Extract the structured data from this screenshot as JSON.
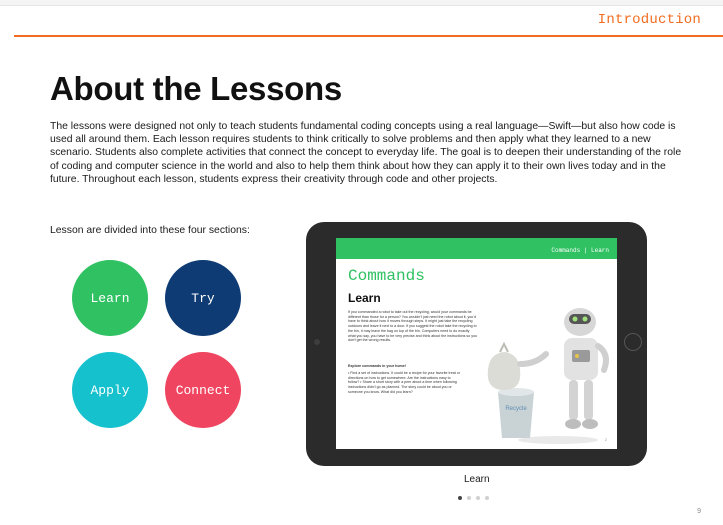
{
  "header": {
    "section_label": "Introduction"
  },
  "page": {
    "title": "About the Lessons",
    "intro": "The lessons were designed not only to teach students fundamental coding concepts using a real language—Swift—but also how code is used all around them. Each lesson requires students to think critically to solve problems and then apply what they learned to a new scenario. Students also complete activities that connect the concept to everyday life. The goal is to deepen their understanding of the role of coding and computer science in the world and also to help them think about how they can apply it to their own lives today and in the future. Throughout each lesson, students express their creativity through code and other projects.",
    "sections_label": "Lesson are divided into these four sections:",
    "page_number": "9"
  },
  "sections": [
    {
      "label": "Learn",
      "color": "#2fc162"
    },
    {
      "label": "Try",
      "color": "#0e3b73"
    },
    {
      "label": "Apply",
      "color": "#15c1cd"
    },
    {
      "label": "Connect",
      "color": "#ef4560"
    }
  ],
  "tablet": {
    "breadcrumb": "Commands | Learn",
    "title": "Commands",
    "subtitle": "Learn",
    "body_text": "If you commanded a robot to take out the recycling, would your commands be different than those for a person? You wouldn't just need the robot about it, you'd have to think about how it moves through steps. It might just take the recycling outdoors and leave it next to a door. If you suggest the robot take the recycling to the bin, it may leave the bag on top of the bin. Computers need to do exactly what you say, you have to be very precise and think about the instructions so you don't get the wrong results.",
    "prompt_heading": "Explore commands in your home!",
    "prompt_text": "• Find a set of instructions. It could be a recipe for your favorite treat or directions on how to get somewhere. Are the instructions easy to follow? • Share a short story with a peer about a time when following instructions didn't go as planned. The story could be about you or someone you know. What did you learn?",
    "recycle_label": "Recycle",
    "screen_page": "2"
  },
  "carousel": {
    "caption": "Learn",
    "dot_count": 4,
    "active_index": 0
  },
  "colors": {
    "accent": "#f26c21",
    "learn": "#2fc162",
    "try": "#0e3b73",
    "apply": "#15c1cd",
    "connect": "#ef4560"
  }
}
